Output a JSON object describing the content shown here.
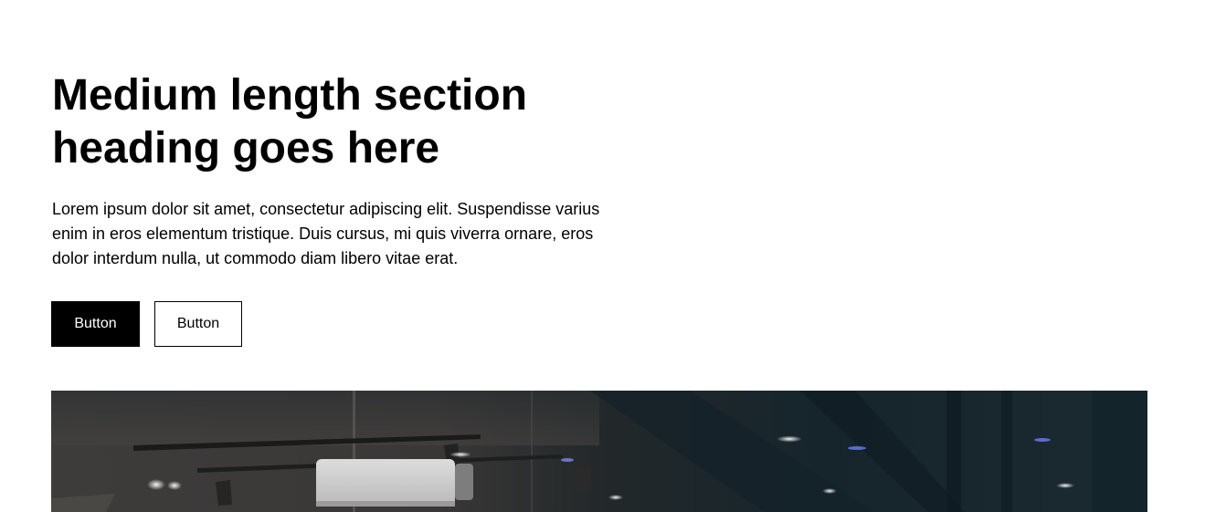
{
  "section": {
    "heading": "Medium length section heading goes here",
    "description": "Lorem ipsum dolor sit amet, consectetur adipiscing elit. Suspendisse varius enim in eros elementum tristique. Duis cursus, mi quis viverra ornare, eros dolor interdum nulla, ut commodo diam libero vitae erat.",
    "buttons": {
      "primary_label": "Button",
      "secondary_label": "Button"
    }
  },
  "colors": {
    "text": "#000000",
    "background": "#ffffff",
    "primary_button_bg": "#000000",
    "primary_button_text": "#ffffff"
  }
}
